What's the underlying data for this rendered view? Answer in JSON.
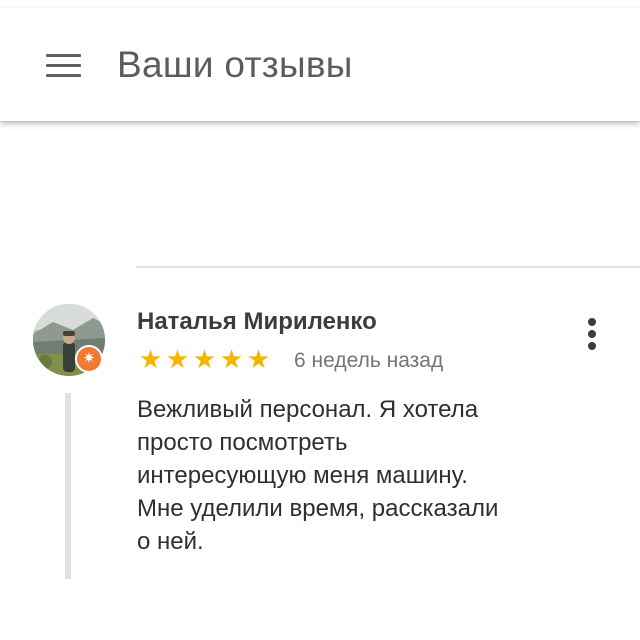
{
  "header": {
    "title": "Ваши отзывы",
    "menu_icon": "hamburger-menu-icon"
  },
  "review": {
    "author": "Наталья Мириленко",
    "rating": 5,
    "rating_max": 5,
    "stars": [
      "★",
      "★",
      "★",
      "★",
      "★"
    ],
    "date": "6 недель назад",
    "text_lines": [
      "Вежливый персонал. Я хотела",
      "просто посмотреть",
      "интересующую меня машину.",
      "Мне уделили время, рассказали",
      "о ней."
    ],
    "more_icon": "more-vertical-icon",
    "badge_icon": "local-guide-star-icon",
    "badge_glyph": "✷"
  },
  "colors": {
    "star": "#f5b400",
    "badge": "#ee7a36",
    "title_text": "#5c5c5c",
    "body_text": "#2f2f2f",
    "muted_text": "#757575"
  }
}
